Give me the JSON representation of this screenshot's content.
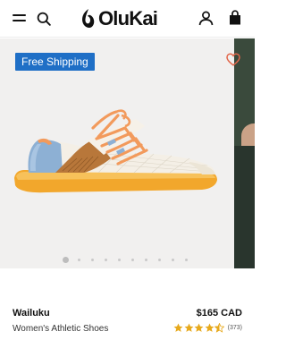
{
  "header": {
    "logo_text": "OluKai"
  },
  "gallery": {
    "badge": "Free Shipping",
    "slide_count": 10,
    "active_slide": 1
  },
  "product": {
    "name": "Wailuku",
    "category": "Women's Athletic Shoes",
    "price": "$165 CAD",
    "rating": 4.5,
    "review_count": "(373)"
  },
  "colors": {
    "badge_bg": "#1f6fc6",
    "star": "#e7a91c",
    "shoe_sole": "#f2a72c",
    "shoe_heel": "#8db0d4",
    "shoe_lace": "#f29a5c",
    "shoe_leather": "#b8773a"
  },
  "icons": [
    "menu-icon",
    "search-icon",
    "account-icon",
    "shopping-bag-icon",
    "heart-icon",
    "star-icon"
  ]
}
